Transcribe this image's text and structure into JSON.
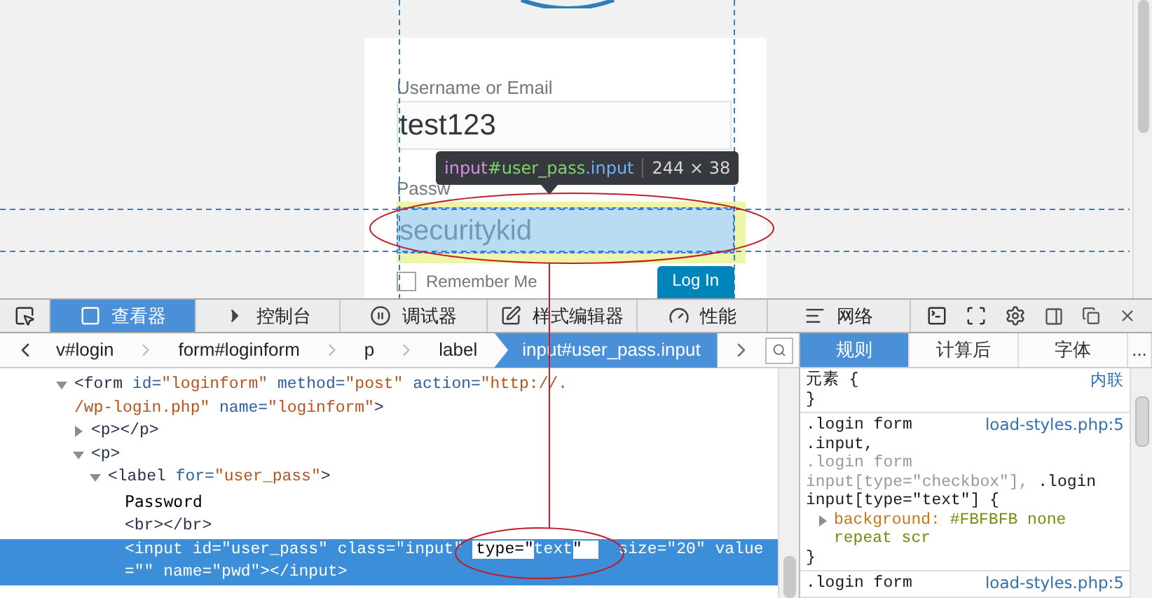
{
  "page": {
    "username_label": "Username or Email",
    "username_value": "test123",
    "password_label": "Passw",
    "password_value": "securitykid",
    "password_highlighted": true,
    "remember_label": "Remember Me",
    "remember_checked": false,
    "login_button": "Log In"
  },
  "highlighter": {
    "tag": "input",
    "id": "#user_pass",
    "class": ".input",
    "size": "244 × 38"
  },
  "toolbar": {
    "tabs": [
      {
        "label": "查看器",
        "selected": true
      },
      {
        "label": "控制台",
        "selected": false
      },
      {
        "label": "调试器",
        "selected": false
      },
      {
        "label": "样式编辑器",
        "selected": false
      },
      {
        "label": "性能",
        "selected": false
      },
      {
        "label": "网络",
        "selected": false
      }
    ]
  },
  "breadcrumbs": [
    {
      "label": "v#login",
      "selected": false
    },
    {
      "label": "form#loginform",
      "selected": false
    },
    {
      "label": "p",
      "selected": false
    },
    {
      "label": "label",
      "selected": false
    },
    {
      "label": "input#user_pass.input",
      "selected": true
    }
  ],
  "markup": [
    {
      "expanded": true,
      "selected": false,
      "tokens": [
        {
          "kind": "tag",
          "t": "<form"
        },
        {
          "kind": "attr",
          "t": " id="
        },
        {
          "kind": "val",
          "t": "\"loginform\""
        },
        {
          "kind": "attr",
          "t": " method="
        },
        {
          "kind": "val",
          "t": "\"post\""
        },
        {
          "kind": "attr",
          "t": " action="
        },
        {
          "kind": "val",
          "t": "\"http://."
        },
        {
          "kind": "newline"
        },
        {
          "kind": "val",
          "t": "/wp-login.php\""
        },
        {
          "kind": "attr",
          "t": " name="
        },
        {
          "kind": "val",
          "t": "\"loginform\""
        },
        {
          "kind": "tag",
          "t": ">"
        }
      ],
      "children": [
        {
          "expanded": false,
          "selected": false,
          "tokens": [
            {
              "kind": "tag",
              "t": "<p></p>"
            }
          ]
        },
        {
          "expanded": true,
          "selected": false,
          "tokens": [
            {
              "kind": "tag",
              "t": "<p>"
            }
          ],
          "children": [
            {
              "expanded": true,
              "selected": false,
              "tokens": [
                {
                  "kind": "tag",
                  "t": "<label"
                },
                {
                  "kind": "attr",
                  "t": " for="
                },
                {
                  "kind": "val",
                  "t": "\"user_pass\""
                },
                {
                  "kind": "tag",
                  "t": ">"
                }
              ],
              "children": [
                {
                  "selected": false,
                  "tokens": [
                    {
                      "kind": "text",
                      "t": "Password"
                    }
                  ]
                },
                {
                  "selected": false,
                  "tokens": [
                    {
                      "kind": "tag",
                      "t": "<br></br>"
                    }
                  ]
                },
                {
                  "selected": true,
                  "tokens": [
                    {
                      "kind": "tag",
                      "t": "<input"
                    },
                    {
                      "kind": "attr",
                      "t": " id="
                    },
                    {
                      "kind": "val",
                      "t": "\"user_pass\""
                    },
                    {
                      "kind": "attr",
                      "t": " class="
                    },
                    {
                      "kind": "val",
                      "t": "\"input\" "
                    },
                    {
                      "kind": "edit",
                      "parts": [
                        {
                          "t": "type=\"",
                          "selected": false
                        },
                        {
                          "t": "text",
                          "selected": true
                        },
                        {
                          "t": "\"",
                          "selected": false
                        }
                      ]
                    },
                    {
                      "kind": "attr",
                      "t": "  size="
                    },
                    {
                      "kind": "val",
                      "t": "\"20\""
                    },
                    {
                      "kind": "attr",
                      "t": " value="
                    },
                    {
                      "kind": "val",
                      "t": "\"\""
                    },
                    {
                      "kind": "attr",
                      "t": " name="
                    },
                    {
                      "kind": "val",
                      "t": "\"pwd\""
                    },
                    {
                      "kind": "tag",
                      "t": "></input>"
                    }
                  ]
                }
              ]
            }
          ]
        }
      ]
    }
  ],
  "sidebar": {
    "tabs": [
      {
        "label": "规则",
        "selected": true
      },
      {
        "label": "计算后",
        "selected": false
      },
      {
        "label": "字体",
        "selected": false
      },
      {
        "label": "...",
        "selected": false
      }
    ],
    "rules": [
      {
        "selector": [
          {
            "t": "元素",
            "matched": true
          }
        ],
        "open": "{",
        "close": "}",
        "source": "内联"
      },
      {
        "selector": [
          {
            "t": ".login form .input,",
            "matched": true
          },
          {
            "t": ".login form input[type=\"checkbox\"],",
            "matched": false
          },
          {
            "t": ".login input[type=\"text\"]",
            "matched": true
          }
        ],
        "open": "{",
        "close": "}",
        "source": "load-styles.php:5",
        "declarations": [
          {
            "name": "background:",
            "value": "#FBFBFB none repeat scr"
          }
        ]
      },
      {
        "selector": [
          {
            "t": ".login form",
            "matched": true
          }
        ],
        "source": "load-styles.php:5"
      }
    ]
  }
}
